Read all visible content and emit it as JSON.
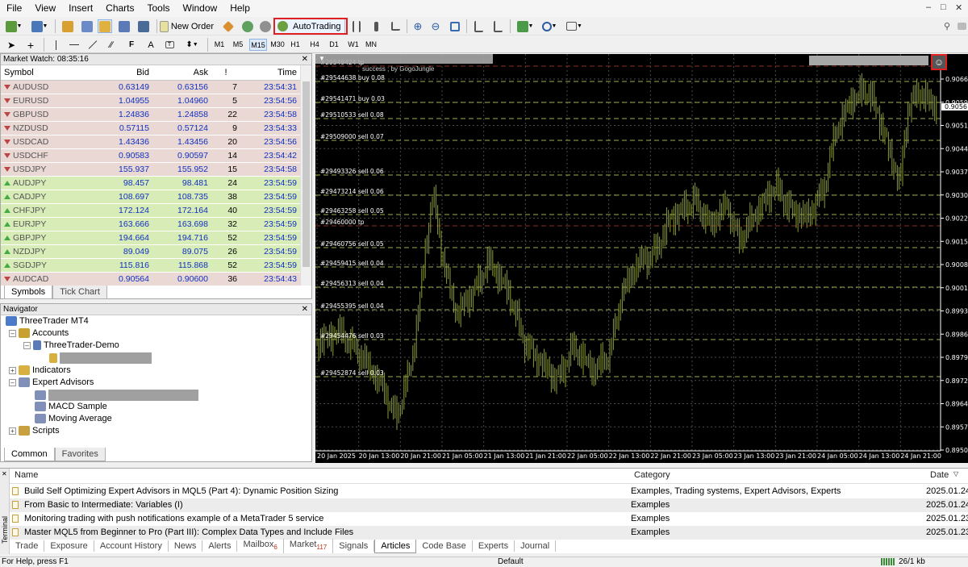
{
  "menu": [
    "File",
    "View",
    "Insert",
    "Charts",
    "Tools",
    "Window",
    "Help"
  ],
  "toolbar": {
    "new_order_label": "New Order",
    "autotrading_label": "AutoTrading"
  },
  "timeframes": [
    "M1",
    "M5",
    "M15",
    "M30",
    "H1",
    "H4",
    "D1",
    "W1",
    "MN"
  ],
  "active_timeframe": "M15",
  "market_watch": {
    "title": "Market Watch: 08:35:16",
    "columns": [
      "Symbol",
      "Bid",
      "Ask",
      "!",
      "Time"
    ],
    "rows": [
      {
        "symbol": "AUDUSD",
        "bid": "0.63149",
        "ask": "0.63156",
        "spread": "7",
        "time": "23:54:31",
        "dir": "down"
      },
      {
        "symbol": "EURUSD",
        "bid": "1.04955",
        "ask": "1.04960",
        "spread": "5",
        "time": "23:54:56",
        "dir": "down"
      },
      {
        "symbol": "GBPUSD",
        "bid": "1.24836",
        "ask": "1.24858",
        "spread": "22",
        "time": "23:54:58",
        "dir": "down"
      },
      {
        "symbol": "NZDUSD",
        "bid": "0.57115",
        "ask": "0.57124",
        "spread": "9",
        "time": "23:54:33",
        "dir": "down"
      },
      {
        "symbol": "USDCAD",
        "bid": "1.43436",
        "ask": "1.43456",
        "spread": "20",
        "time": "23:54:56",
        "dir": "down"
      },
      {
        "symbol": "USDCHF",
        "bid": "0.90583",
        "ask": "0.90597",
        "spread": "14",
        "time": "23:54:42",
        "dir": "down"
      },
      {
        "symbol": "USDJPY",
        "bid": "155.937",
        "ask": "155.952",
        "spread": "15",
        "time": "23:54:58",
        "dir": "down"
      },
      {
        "symbol": "AUDJPY",
        "bid": "98.457",
        "ask": "98.481",
        "spread": "24",
        "time": "23:54:59",
        "dir": "up"
      },
      {
        "symbol": "CADJPY",
        "bid": "108.697",
        "ask": "108.735",
        "spread": "38",
        "time": "23:54:59",
        "dir": "up"
      },
      {
        "symbol": "CHFJPY",
        "bid": "172.124",
        "ask": "172.164",
        "spread": "40",
        "time": "23:54:59",
        "dir": "up"
      },
      {
        "symbol": "EURJPY",
        "bid": "163.666",
        "ask": "163.698",
        "spread": "32",
        "time": "23:54:59",
        "dir": "up"
      },
      {
        "symbol": "GBPJPY",
        "bid": "194.664",
        "ask": "194.716",
        "spread": "52",
        "time": "23:54:59",
        "dir": "up"
      },
      {
        "symbol": "NZDJPY",
        "bid": "89.049",
        "ask": "89.075",
        "spread": "26",
        "time": "23:54:59",
        "dir": "up"
      },
      {
        "symbol": "SGDJPY",
        "bid": "115.816",
        "ask": "115.868",
        "spread": "52",
        "time": "23:54:59",
        "dir": "up"
      },
      {
        "symbol": "AUDCAD",
        "bid": "0.90564",
        "ask": "0.90600",
        "spread": "36",
        "time": "23:54:43",
        "dir": "down"
      }
    ],
    "tabs": [
      "Symbols",
      "Tick Chart"
    ]
  },
  "navigator": {
    "title": "Navigator",
    "root": "ThreeTrader MT4",
    "accounts": "Accounts",
    "account_server": "ThreeTrader-Demo",
    "indicators": "Indicators",
    "expert_advisors": "Expert Advisors",
    "ea_items": [
      "MACD Sample",
      "Moving Average"
    ],
    "scripts": "Scripts",
    "tabs": [
      "Common",
      "Favorites"
    ]
  },
  "chart": {
    "header_text": "success ; by GogoJungle",
    "y_labels": [
      "0.9066",
      "0.9059",
      "0.9051",
      "0.9044",
      "0.9037",
      "0.9030",
      "0.9022",
      "0.9015",
      "0.9008",
      "0.9001",
      "0.8993",
      "0.8986",
      "0.8979",
      "0.8972",
      "0.8964",
      "0.8957",
      "0.8950"
    ],
    "current_price": "0.9056",
    "x_labels": [
      "20 Jan 2025",
      "20 Jan 13:00",
      "20 Jan 21:00",
      "21 Jan 05:00",
      "21 Jan 13:00",
      "21 Jan 21:00",
      "22 Jan 05:00",
      "22 Jan 13:00",
      "22 Jan 21:00",
      "23 Jan 05:00",
      "23 Jan 13:00",
      "23 Jan 21:00",
      "24 Jan 05:00",
      "24 Jan 13:00",
      "24 Jan 21:00"
    ],
    "order_labels": [
      {
        "text": "#29549424 tp",
        "kind": "tp"
      },
      {
        "text": "#29544638 buy 0.08",
        "kind": "buy"
      },
      {
        "text": "#29541471 buy 0.03",
        "kind": "buy"
      },
      {
        "text": "#29510533 sell 0.08",
        "kind": "sell"
      },
      {
        "text": "#29509000 sell 0.07",
        "kind": "sell"
      },
      {
        "text": "#29493326 sell 0.06",
        "kind": "sell"
      },
      {
        "text": "#29473214 sell 0.06",
        "kind": "sell"
      },
      {
        "text": "#29463258 sell 0.05",
        "kind": "sell"
      },
      {
        "text": "#29460000 tp",
        "kind": "tp"
      },
      {
        "text": "#29460756 sell 0.05",
        "kind": "sell"
      },
      {
        "text": "#29459415 sell 0.04",
        "kind": "sell"
      },
      {
        "text": "#29456313 sell 0.04",
        "kind": "sell"
      },
      {
        "text": "#29455395 sell 0.04",
        "kind": "sell"
      },
      {
        "text": "#29454476 sell 0.03",
        "kind": "sell"
      },
      {
        "text": "#29452874 sell 0.03",
        "kind": "sell"
      }
    ],
    "colors": {
      "candle": "#8a9a3a",
      "grid": "#4a4a4a",
      "tp_line": "#8a3020",
      "order_line": "#9ab04a",
      "bg": "#000000"
    }
  },
  "terminal": {
    "columns": [
      "Name",
      "Category",
      "Date"
    ],
    "rows": [
      {
        "name": "Build Self Optimizing Expert Advisors in MQL5 (Part 4): Dynamic Position Sizing",
        "category": "Examples, Trading systems, Expert Advisors, Experts",
        "date": "2025.01.24"
      },
      {
        "name": "From Basic to Intermediate: Variables (I)",
        "category": "Examples",
        "date": "2025.01.24"
      },
      {
        "name": "Monitoring trading with push notifications  example of a MetaTrader 5 service",
        "category": "Examples",
        "date": "2025.01.23"
      },
      {
        "name": "Master MQL5 from Beginner to Pro (Part III): Complex Data Types and Include Files",
        "category": "Examples",
        "date": "2025.01.23"
      }
    ],
    "side_label": "Terminal",
    "tabs": [
      {
        "label": "Trade"
      },
      {
        "label": "Exposure"
      },
      {
        "label": "Account History"
      },
      {
        "label": "News"
      },
      {
        "label": "Alerts"
      },
      {
        "label": "Mailbox",
        "badge": "6"
      },
      {
        "label": "Market",
        "badge": "117"
      },
      {
        "label": "Signals"
      },
      {
        "label": "Articles",
        "active": true
      },
      {
        "label": "Code Base"
      },
      {
        "label": "Experts"
      },
      {
        "label": "Journal"
      }
    ]
  },
  "status": {
    "help": "For Help, press F1",
    "profile": "Default",
    "traffic": "26/1 kb"
  }
}
